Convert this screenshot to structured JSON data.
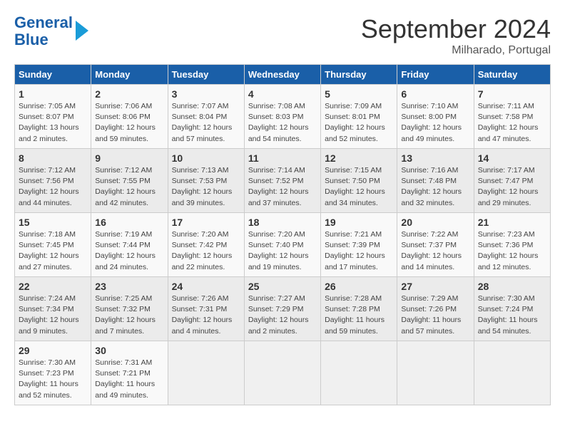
{
  "header": {
    "logo_line1": "General",
    "logo_line2": "Blue",
    "title": "September 2024",
    "subtitle": "Milharado, Portugal"
  },
  "days_of_week": [
    "Sunday",
    "Monday",
    "Tuesday",
    "Wednesday",
    "Thursday",
    "Friday",
    "Saturday"
  ],
  "weeks": [
    [
      {
        "day": "1",
        "info": "Sunrise: 7:05 AM\nSunset: 8:07 PM\nDaylight: 13 hours\nand 2 minutes."
      },
      {
        "day": "2",
        "info": "Sunrise: 7:06 AM\nSunset: 8:06 PM\nDaylight: 12 hours\nand 59 minutes."
      },
      {
        "day": "3",
        "info": "Sunrise: 7:07 AM\nSunset: 8:04 PM\nDaylight: 12 hours\nand 57 minutes."
      },
      {
        "day": "4",
        "info": "Sunrise: 7:08 AM\nSunset: 8:03 PM\nDaylight: 12 hours\nand 54 minutes."
      },
      {
        "day": "5",
        "info": "Sunrise: 7:09 AM\nSunset: 8:01 PM\nDaylight: 12 hours\nand 52 minutes."
      },
      {
        "day": "6",
        "info": "Sunrise: 7:10 AM\nSunset: 8:00 PM\nDaylight: 12 hours\nand 49 minutes."
      },
      {
        "day": "7",
        "info": "Sunrise: 7:11 AM\nSunset: 7:58 PM\nDaylight: 12 hours\nand 47 minutes."
      }
    ],
    [
      {
        "day": "8",
        "info": "Sunrise: 7:12 AM\nSunset: 7:56 PM\nDaylight: 12 hours\nand 44 minutes."
      },
      {
        "day": "9",
        "info": "Sunrise: 7:12 AM\nSunset: 7:55 PM\nDaylight: 12 hours\nand 42 minutes."
      },
      {
        "day": "10",
        "info": "Sunrise: 7:13 AM\nSunset: 7:53 PM\nDaylight: 12 hours\nand 39 minutes."
      },
      {
        "day": "11",
        "info": "Sunrise: 7:14 AM\nSunset: 7:52 PM\nDaylight: 12 hours\nand 37 minutes."
      },
      {
        "day": "12",
        "info": "Sunrise: 7:15 AM\nSunset: 7:50 PM\nDaylight: 12 hours\nand 34 minutes."
      },
      {
        "day": "13",
        "info": "Sunrise: 7:16 AM\nSunset: 7:48 PM\nDaylight: 12 hours\nand 32 minutes."
      },
      {
        "day": "14",
        "info": "Sunrise: 7:17 AM\nSunset: 7:47 PM\nDaylight: 12 hours\nand 29 minutes."
      }
    ],
    [
      {
        "day": "15",
        "info": "Sunrise: 7:18 AM\nSunset: 7:45 PM\nDaylight: 12 hours\nand 27 minutes."
      },
      {
        "day": "16",
        "info": "Sunrise: 7:19 AM\nSunset: 7:44 PM\nDaylight: 12 hours\nand 24 minutes."
      },
      {
        "day": "17",
        "info": "Sunrise: 7:20 AM\nSunset: 7:42 PM\nDaylight: 12 hours\nand 22 minutes."
      },
      {
        "day": "18",
        "info": "Sunrise: 7:20 AM\nSunset: 7:40 PM\nDaylight: 12 hours\nand 19 minutes."
      },
      {
        "day": "19",
        "info": "Sunrise: 7:21 AM\nSunset: 7:39 PM\nDaylight: 12 hours\nand 17 minutes."
      },
      {
        "day": "20",
        "info": "Sunrise: 7:22 AM\nSunset: 7:37 PM\nDaylight: 12 hours\nand 14 minutes."
      },
      {
        "day": "21",
        "info": "Sunrise: 7:23 AM\nSunset: 7:36 PM\nDaylight: 12 hours\nand 12 minutes."
      }
    ],
    [
      {
        "day": "22",
        "info": "Sunrise: 7:24 AM\nSunset: 7:34 PM\nDaylight: 12 hours\nand 9 minutes."
      },
      {
        "day": "23",
        "info": "Sunrise: 7:25 AM\nSunset: 7:32 PM\nDaylight: 12 hours\nand 7 minutes."
      },
      {
        "day": "24",
        "info": "Sunrise: 7:26 AM\nSunset: 7:31 PM\nDaylight: 12 hours\nand 4 minutes."
      },
      {
        "day": "25",
        "info": "Sunrise: 7:27 AM\nSunset: 7:29 PM\nDaylight: 12 hours\nand 2 minutes."
      },
      {
        "day": "26",
        "info": "Sunrise: 7:28 AM\nSunset: 7:28 PM\nDaylight: 11 hours\nand 59 minutes."
      },
      {
        "day": "27",
        "info": "Sunrise: 7:29 AM\nSunset: 7:26 PM\nDaylight: 11 hours\nand 57 minutes."
      },
      {
        "day": "28",
        "info": "Sunrise: 7:30 AM\nSunset: 7:24 PM\nDaylight: 11 hours\nand 54 minutes."
      }
    ],
    [
      {
        "day": "29",
        "info": "Sunrise: 7:30 AM\nSunset: 7:23 PM\nDaylight: 11 hours\nand 52 minutes."
      },
      {
        "day": "30",
        "info": "Sunrise: 7:31 AM\nSunset: 7:21 PM\nDaylight: 11 hours\nand 49 minutes."
      },
      {
        "day": "",
        "info": ""
      },
      {
        "day": "",
        "info": ""
      },
      {
        "day": "",
        "info": ""
      },
      {
        "day": "",
        "info": ""
      },
      {
        "day": "",
        "info": ""
      }
    ]
  ]
}
